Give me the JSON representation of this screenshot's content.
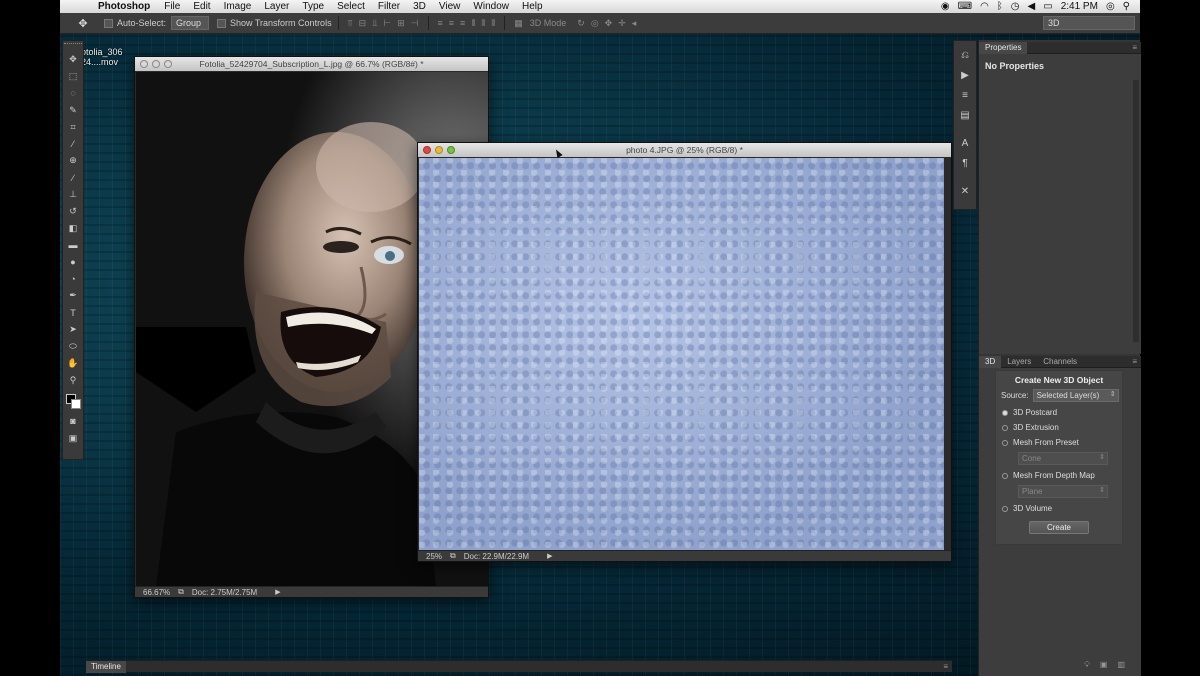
{
  "menubar": {
    "app_name": "Photoshop",
    "items": [
      "File",
      "Edit",
      "Image",
      "Layer",
      "Type",
      "Select",
      "Filter",
      "3D",
      "View",
      "Window",
      "Help"
    ],
    "clock": "2:41 PM"
  },
  "options": {
    "auto_select_label": "Auto-Select:",
    "auto_select_value": "Group",
    "transform_label": "Show Transform Controls",
    "mode_3d_label": "3D Mode",
    "workspace_value": "3D"
  },
  "desktop": {
    "file_label_line1": "otolia_306",
    "file_label_line2": "24....mov"
  },
  "doc1": {
    "title": "Fotolia_52429704_Subscription_L.jpg @ 66.7% (RGB/8#) *",
    "zoom": "66.67%",
    "doc_size": "Doc: 2.75M/2.75M"
  },
  "doc2": {
    "title": "photo 4.JPG @ 25% (RGB/8) *",
    "zoom": "25%",
    "doc_size": "Doc: 22.9M/22.9M"
  },
  "properties": {
    "tab": "Properties",
    "empty_text": "No Properties"
  },
  "panel3d": {
    "tabs": [
      "3D",
      "Layers",
      "Channels"
    ],
    "heading": "Create New 3D Object",
    "source_label": "Source:",
    "source_value": "Selected Layer(s)",
    "options": [
      "3D Postcard",
      "3D Extrusion",
      "Mesh From Preset",
      "Mesh From Depth Map",
      "3D Volume"
    ],
    "preset_value": "Cone",
    "depth_value": "Plane",
    "create_label": "Create"
  },
  "timeline": {
    "tab": "Timeline"
  },
  "colors": {
    "ui_dark": "#3d3d3d",
    "canvas_blue": "#9aaccf",
    "close_red": "#e0473f",
    "min_yellow": "#e8b93a",
    "max_green": "#7bc043"
  }
}
